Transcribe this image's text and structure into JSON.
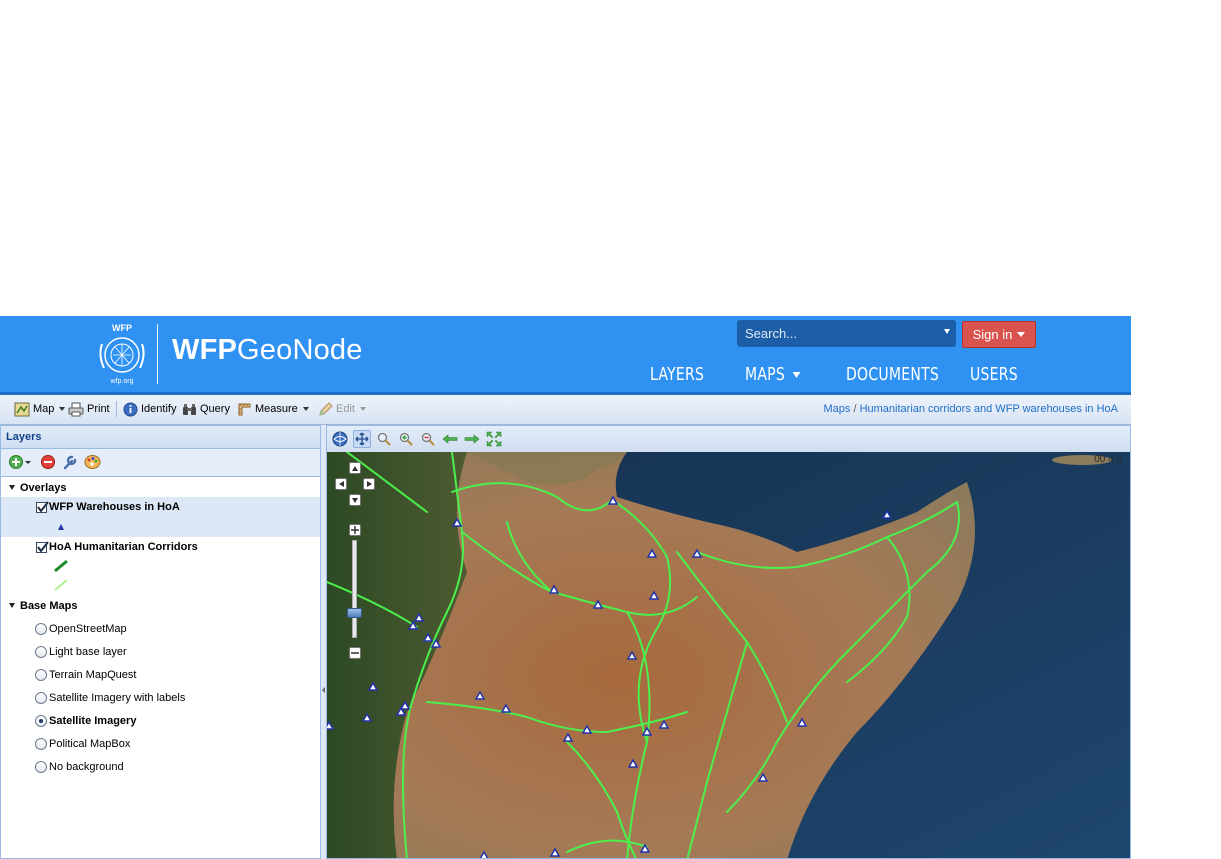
{
  "header": {
    "logo_text_top": "WFP",
    "logo_text_bottom": "wfp.org",
    "brand_bold": "WFP",
    "brand_light": "GeoNode",
    "search_placeholder": "Search...",
    "signin_label": "Sign in",
    "nav": [
      {
        "label": "LAYERS"
      },
      {
        "label": "MAPS"
      },
      {
        "label": "DOCUMENTS"
      },
      {
        "label": "USERS"
      }
    ],
    "colors": {
      "bar": "#2f92f2",
      "signin": "#d9534f"
    }
  },
  "toolbar": {
    "map_label": "Map",
    "print_label": "Print",
    "identify_label": "Identify",
    "query_label": "Query",
    "measure_label": "Measure",
    "edit_label": "Edit",
    "breadcrumb": {
      "root": "Maps",
      "separator": "/",
      "current": "Humanitarian corridors and WFP warehouses in HoA"
    }
  },
  "layers_panel": {
    "title": "Layers",
    "overlays_label": "Overlays",
    "overlays": [
      {
        "label": "WFP Warehouses in HoA",
        "checked": true,
        "selected": true
      },
      {
        "label": "HoA Humanitarian Corridors",
        "checked": true,
        "selected": false
      }
    ],
    "base_maps_label": "Base Maps",
    "base_maps": [
      {
        "label": "OpenStreetMap",
        "selected": false
      },
      {
        "label": "Light base layer",
        "selected": false
      },
      {
        "label": "Terrain MapQuest",
        "selected": false
      },
      {
        "label": "Satellite Imagery with labels",
        "selected": false
      },
      {
        "label": "Satellite Imagery",
        "selected": true
      },
      {
        "label": "Political MapBox",
        "selected": false
      },
      {
        "label": "No background",
        "selected": false
      }
    ]
  },
  "map": {
    "coordinates_readout": "00 4 8",
    "base_layer": "Satellite Imagery",
    "corridor_color": "#4cf04c",
    "warehouse_marker_color": "#2233aa"
  }
}
